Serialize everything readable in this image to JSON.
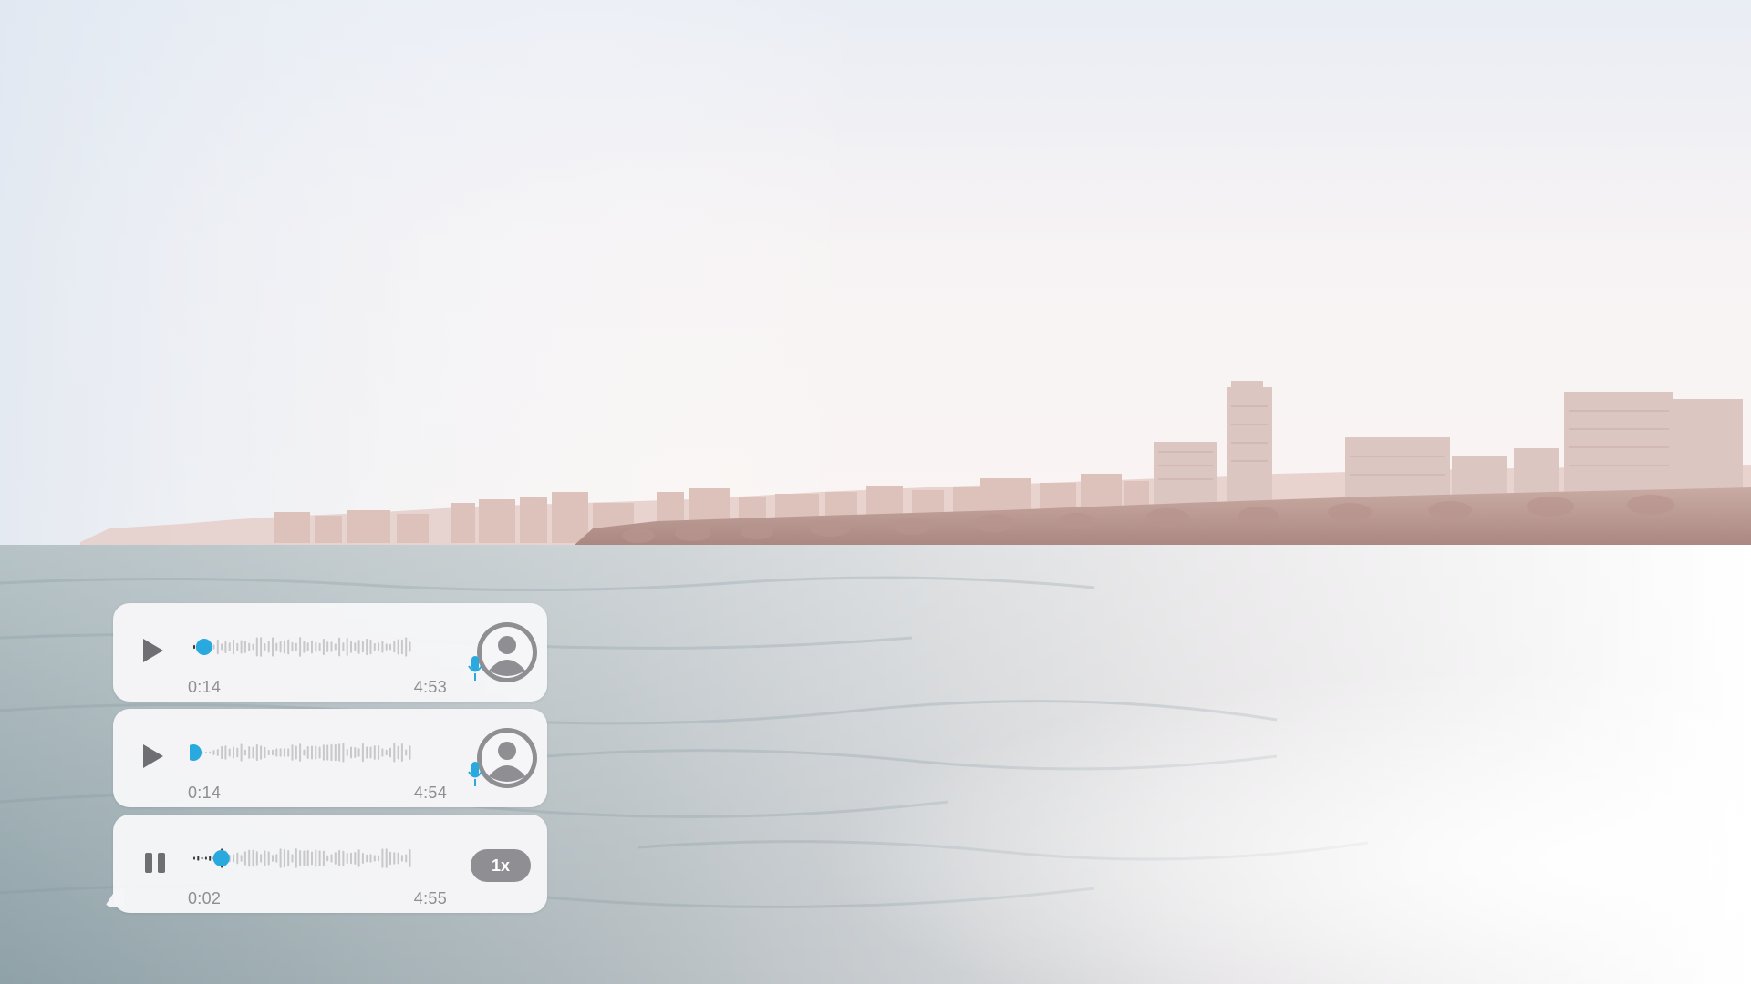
{
  "messages": [
    {
      "state": "paused",
      "elapsed": "0:14",
      "duration": "4:53",
      "progress": 0.05,
      "has_avatar": true,
      "icon": "play-icon"
    },
    {
      "state": "paused",
      "elapsed": "0:14",
      "duration": "4:54",
      "progress": 0.0,
      "has_avatar": true,
      "icon": "play-icon"
    },
    {
      "state": "playing",
      "elapsed": "0:02",
      "duration": "4:55",
      "progress": 0.13,
      "speed": "1x",
      "icon": "pause-icon"
    }
  ],
  "colors": {
    "accent": "#2aa9df",
    "bubble": "#f6f6f8",
    "waveform": "#c7c7cc",
    "text_muted": "#8e8e93",
    "avatar": "#8e8e93"
  }
}
